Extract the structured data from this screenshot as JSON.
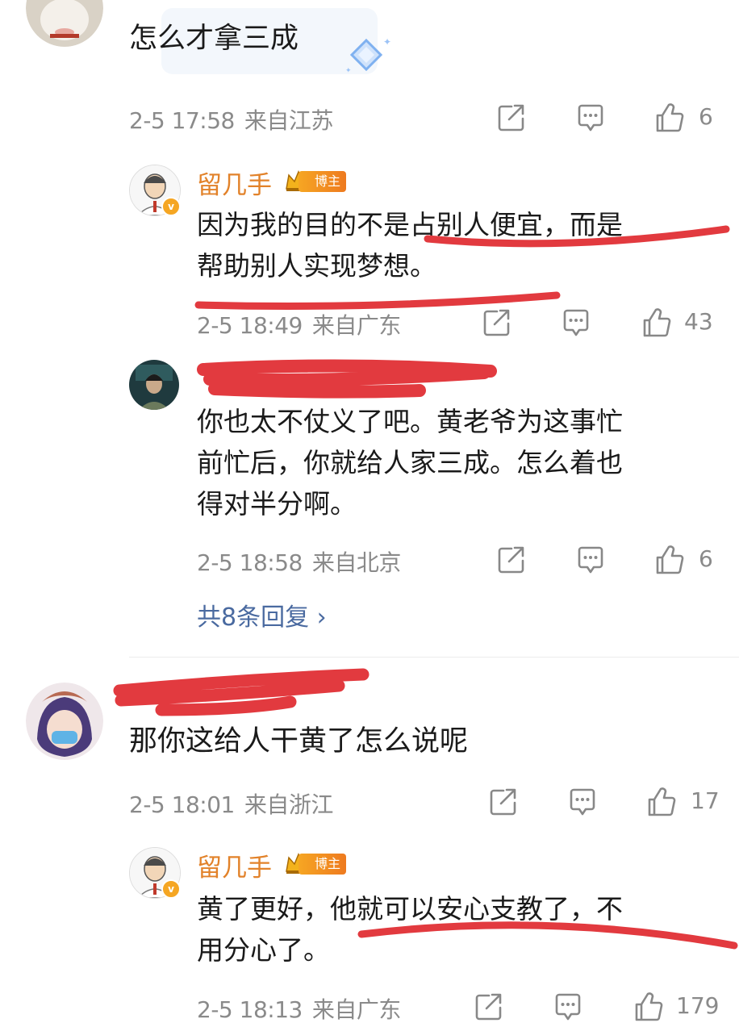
{
  "comments": [
    {
      "text": "怎么才拿三成",
      "time": "2-5 17:58",
      "location": "来自江苏",
      "likes": "6",
      "replies": [
        {
          "user": "留几手",
          "tag": "博主",
          "line1": "因为我的目的不是占别人便宜，而是",
          "line2": "帮助别人实现梦想。",
          "time": "2-5 18:49",
          "location": "来自广东",
          "likes": "43"
        },
        {
          "user": "",
          "line1": "你也太不仗义了吧。黄老爷为这事忙",
          "line2": "前忙后，你就给人家三成。怎么着也",
          "line3": "得对半分啊。",
          "time": "2-5 18:58",
          "location": "来自北京",
          "likes": "6"
        }
      ],
      "more_replies": "共8条回复 ›"
    },
    {
      "text": "那你这给人干黄了怎么说呢",
      "time": "2-5 18:01",
      "location": "来自浙江",
      "likes": "17",
      "replies": [
        {
          "user": "留几手",
          "tag": "博主",
          "line1": "黄了更好，他就可以安心支教了，不",
          "line2": "用分心了。",
          "time": "2-5 18:13",
          "location": "来自广东",
          "likes": "179"
        }
      ]
    }
  ],
  "icons": {
    "share": "share-icon",
    "comment": "comment-icon",
    "like": "like-icon",
    "verified": "verified-badge-icon",
    "crown": "crown-icon"
  },
  "colors": {
    "username": "#e2822a",
    "meta": "#8a8a8a",
    "link": "#4a6aa0",
    "annotation_red": "#e23a3f"
  }
}
